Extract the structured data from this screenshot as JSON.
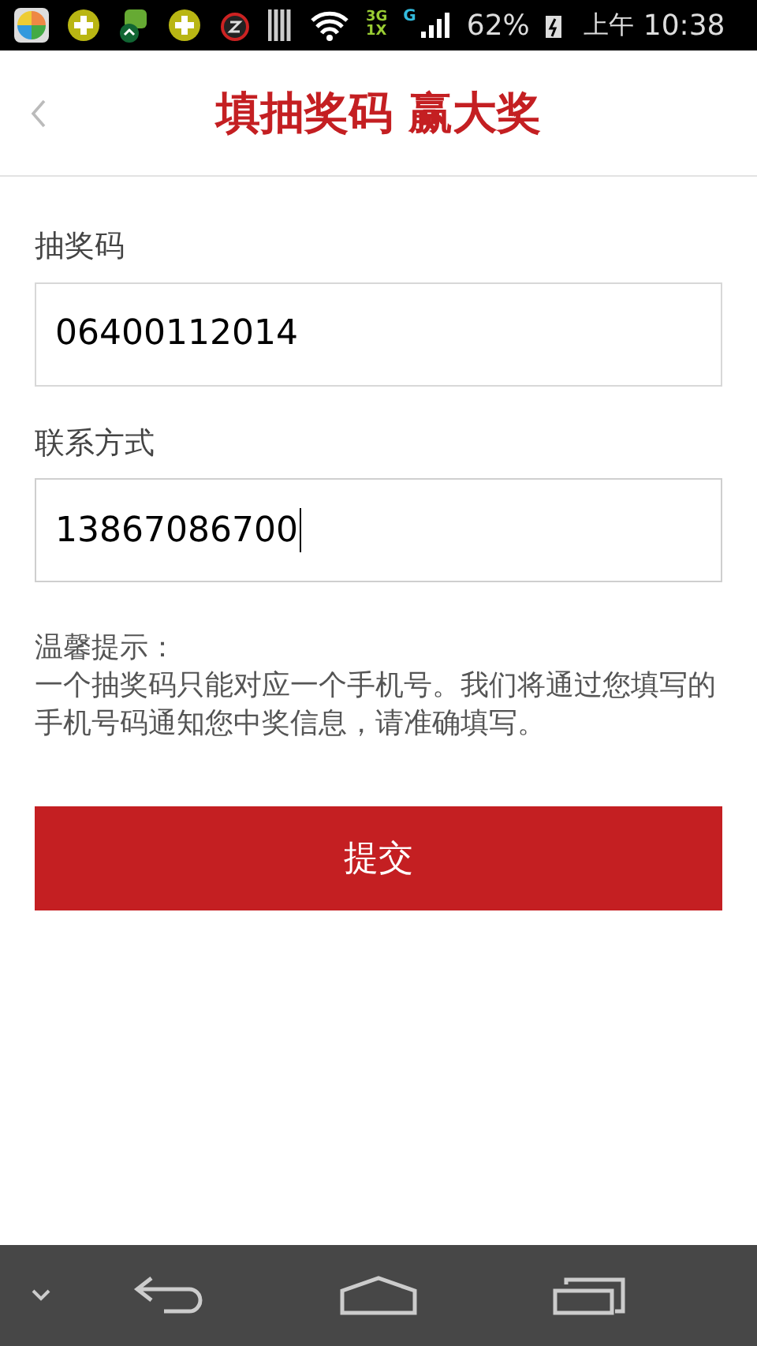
{
  "status_bar": {
    "network_top": "3G",
    "network_bottom": "1X",
    "network_second": "G",
    "battery": "62%",
    "period": "上午",
    "time": "10:38"
  },
  "header": {
    "title": "填抽奖码 赢大奖"
  },
  "form": {
    "fields": [
      {
        "label": "抽奖码",
        "value": "06400112014",
        "focused": false
      },
      {
        "label": "联系方式",
        "value": "13867086700",
        "focused": true
      }
    ],
    "tip_title": "温馨提示：",
    "tip_text": "一个抽奖码只能对应一个手机号。我们将通过您填写的手机号码通知您中奖信息，请准确填写。",
    "submit": "提交"
  }
}
